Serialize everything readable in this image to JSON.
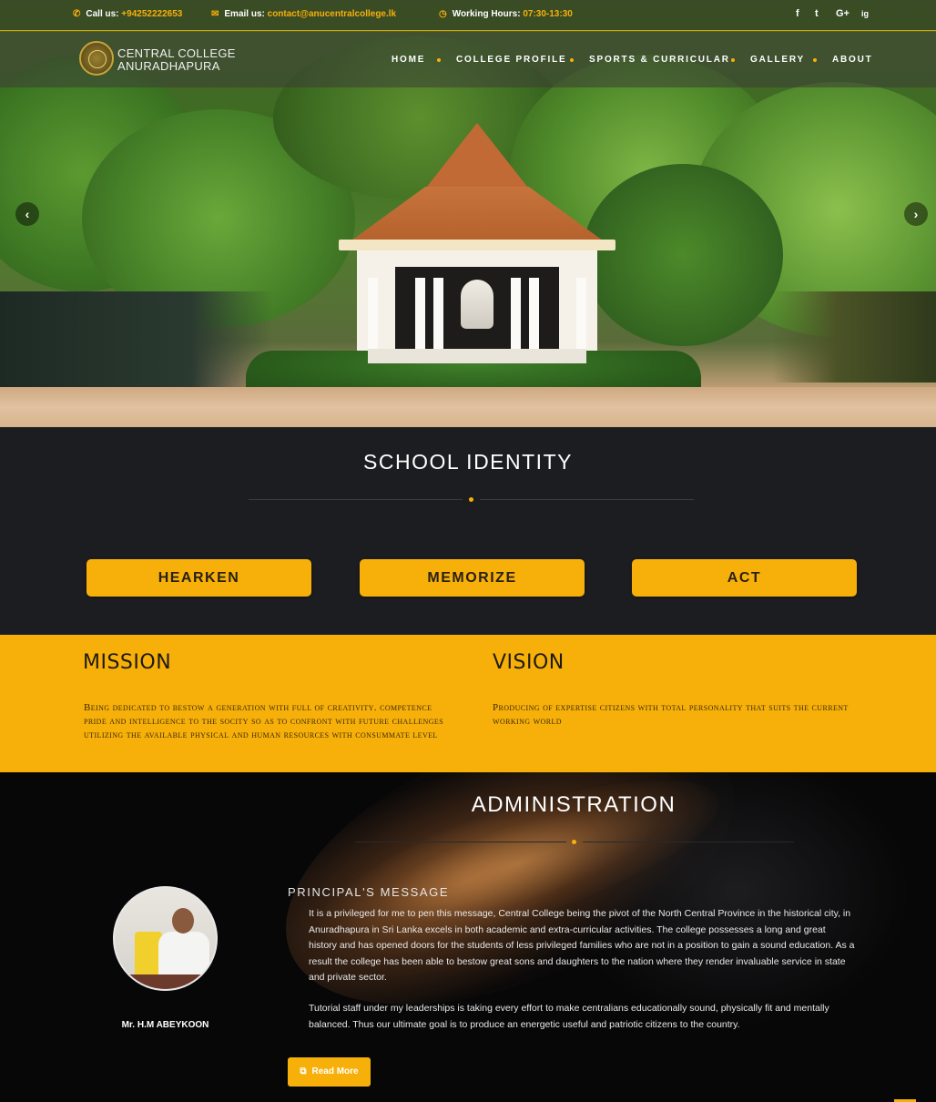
{
  "topbar": {
    "call_label": "Call us:",
    "call_value": "+94252222653",
    "email_label": "Email us:",
    "email_value": "contact@anucentralcollege.lk",
    "hours_label": "Working Hours:",
    "hours_value": "07:30-13:30",
    "social": [
      "f",
      "t",
      "G+",
      "ig"
    ]
  },
  "logo": {
    "line1": "CENTRAL COLLEGE",
    "line2": "ANURADHAPURA"
  },
  "nav": [
    "HOME",
    "COLLEGE PROFILE",
    "SPORTS & CURRICULAR",
    "GALLERY",
    "ABOUT"
  ],
  "slider": {
    "prev": "‹",
    "next": "›"
  },
  "identity": {
    "title": "SCHOOL IDENTITY",
    "values": [
      "HEARKEN",
      "MEMORIZE",
      "ACT"
    ]
  },
  "mission": {
    "title": "MISSION",
    "text": "Being dedicated to bestow a generation with full of creativity. competence pride and intelligence to the socity so as to confront with future challenges utilizing the available physical and human resources with consummate level"
  },
  "vision": {
    "title": "VISION",
    "text": "Producing of expertise citizens with total personality that suits the current working world"
  },
  "admin": {
    "title": "ADMINISTRATION",
    "principal_name": "Mr. H.M ABEYKOON",
    "message_title": "PRINCIPAL'S MESSAGE",
    "paragraph1": "It is a privileged for me to pen this message, Central College being the pivot of the North Central Province in the historical city, in Anuradhapura in Sri Lanka excels in both academic and extra-curricular activities. The college possesses a long and great history and has opened doors for the students of less privileged families who are not in a position to gain a sound education. As a result the college has been able to bestow great sons and daughters to the nation where they render invaluable service in state and private sector.",
    "paragraph2": "Tutorial staff under my leaderships is taking every effort to make centralians educationally sound, physically fit and mentally balanced. Thus our ultimate goal is to produce an energetic useful and patriotic citizens to the country.",
    "read_more": "Read More"
  },
  "colors": {
    "accent": "#f7b00a",
    "dark": "#1c1d20",
    "black": "#070708"
  }
}
